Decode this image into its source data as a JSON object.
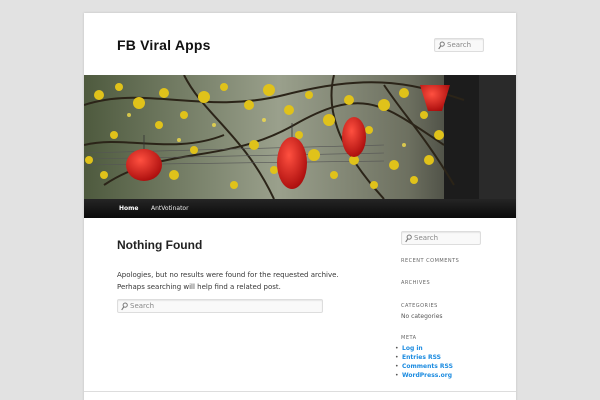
{
  "header": {
    "site_title": "FB Viral Apps",
    "search_placeholder": "Search"
  },
  "nav": {
    "items": [
      {
        "label": "Home"
      },
      {
        "label": "AntVotinator"
      }
    ]
  },
  "content": {
    "title": "Nothing Found",
    "message": "Apologies, but no results were found for the requested archive. Perhaps searching will help find a related post.",
    "search_placeholder": "Search"
  },
  "sidebar": {
    "search_placeholder": "Search",
    "recent_comments_title": "RECENT COMMENTS",
    "archives_title": "ARCHIVES",
    "categories_title": "CATEGORIES",
    "categories_empty": "No categories",
    "meta_title": "META",
    "meta_links": [
      {
        "label": "Log in"
      },
      {
        "label": "Entries RSS"
      },
      {
        "label": "Comments RSS"
      },
      {
        "label": "WordPress.org"
      }
    ]
  },
  "icons": {
    "search": "search-icon"
  },
  "colors": {
    "background": "#e2e2e2",
    "nav_bar": "#111111",
    "link": "#1b8be0"
  }
}
